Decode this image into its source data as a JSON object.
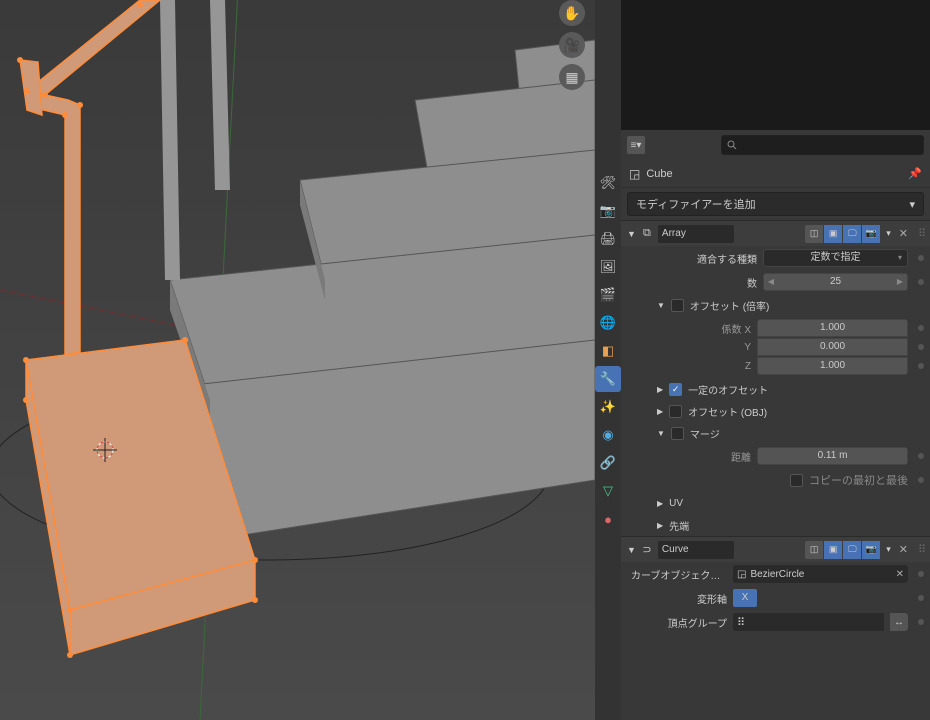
{
  "viewport": {
    "gizmos": [
      "hand-icon",
      "camera-icon",
      "grid-icon"
    ]
  },
  "search": {
    "placeholder": ""
  },
  "object": {
    "name": "Cube"
  },
  "add_modifier": {
    "label": "モディファイアーを追加"
  },
  "modifiers": [
    {
      "name": "Array",
      "fit_type_label": "適合する種類",
      "fit_type_value": "定数で指定",
      "count_label": "数",
      "count_value": "25",
      "relative_offset": {
        "label": "オフセット (倍率)",
        "checked": false,
        "x_label": "係数 X",
        "x": "1.000",
        "y_label": "Y",
        "y": "0.000",
        "z_label": "Z",
        "z": "1.000"
      },
      "constant_offset": {
        "label": "一定のオフセット",
        "checked": true
      },
      "object_offset": {
        "label": "オフセット (OBJ)",
        "checked": false
      },
      "merge": {
        "label": "マージ",
        "checked": false,
        "distance_label": "距離",
        "distance_value": "0.11 m",
        "first_last_label": "コピーの最初と最後",
        "first_last_checked": false
      },
      "uv_label": "UV",
      "caps_label": "先端"
    },
    {
      "name": "Curve",
      "curve_obj_label": "カーブオブジェク…",
      "curve_obj_value": "BezierCircle",
      "deform_axis_label": "変形軸",
      "deform_axis_value": "X",
      "vgroup_label": "頂点グループ"
    }
  ],
  "tabs": [
    "tool",
    "render",
    "output",
    "view",
    "scene",
    "world",
    "object-orange",
    "constraint",
    "wrench",
    "particle",
    "physics",
    "curve-green",
    "material"
  ]
}
